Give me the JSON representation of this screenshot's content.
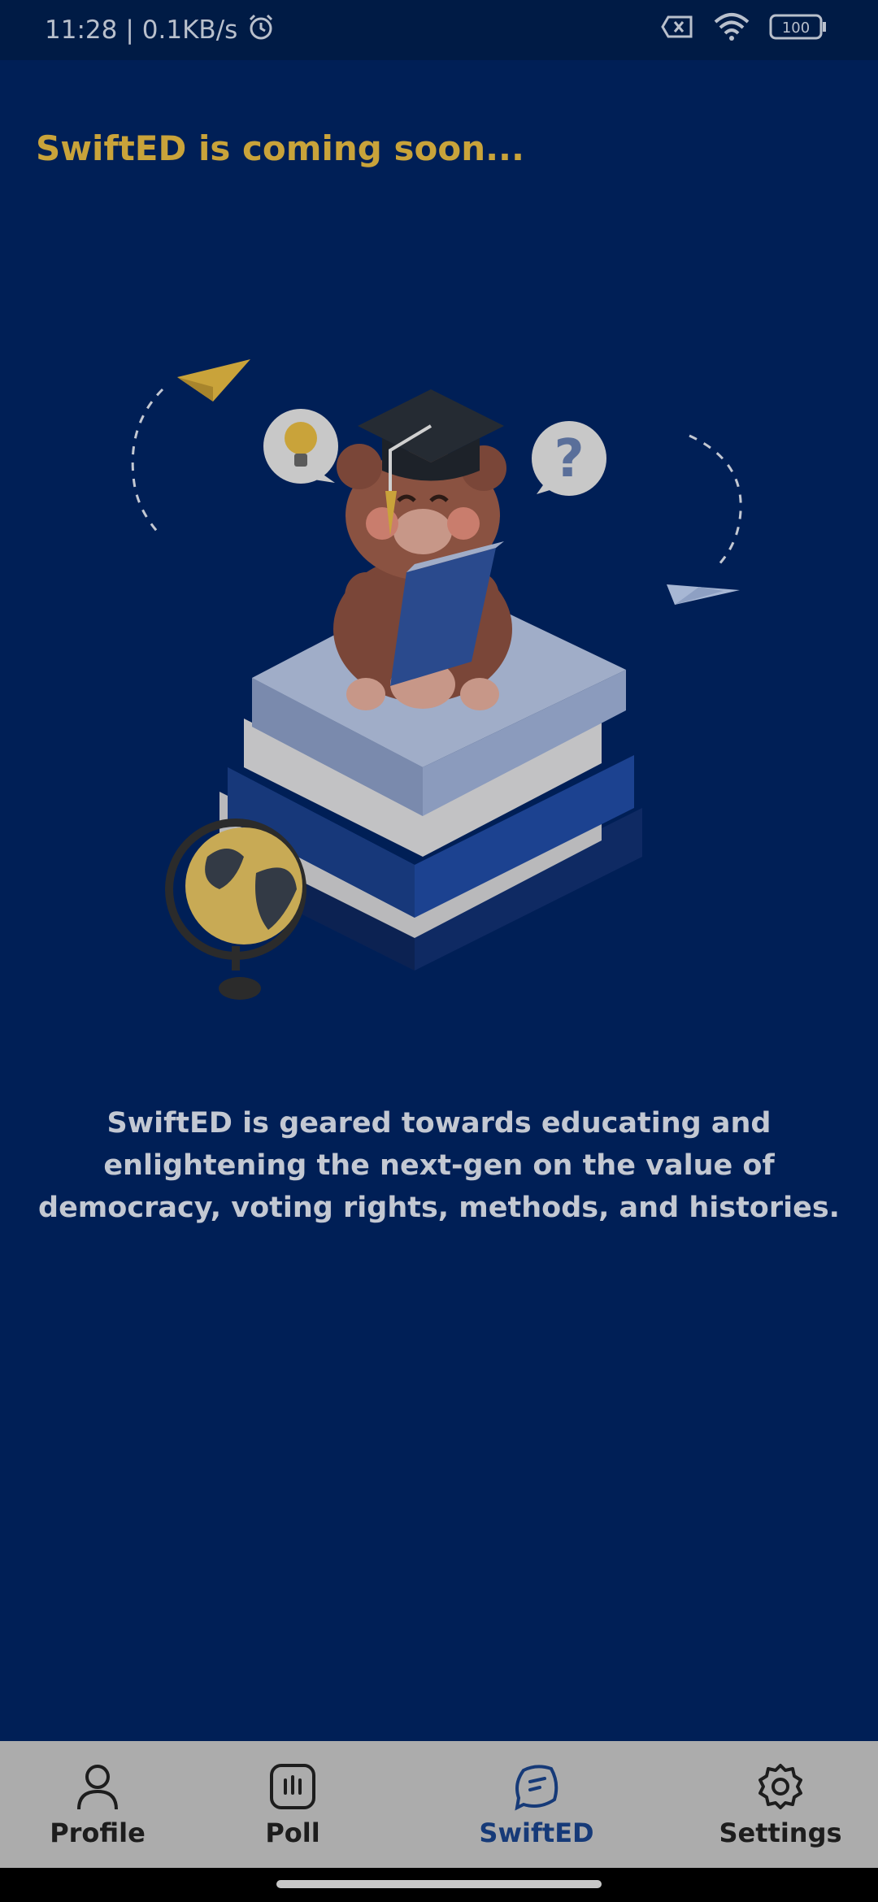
{
  "status_bar": {
    "time": "11:28",
    "separator": "|",
    "speed": "0.1KB/s",
    "battery": "100"
  },
  "screen": {
    "title": "SwiftED is coming soon...",
    "description": "SwiftED is geared towards educating and enlightening the next-gen on the value of democracy, voting rights, methods, and histories."
  },
  "nav": {
    "profile": "Profile",
    "poll": "Poll",
    "swifted": "SwiftED",
    "settings": "Settings",
    "active": "SwiftED"
  },
  "colors": {
    "background": "#001f56",
    "accent": "#c9a33a",
    "nav_background": "#acacac",
    "nav_active": "#163a78"
  }
}
